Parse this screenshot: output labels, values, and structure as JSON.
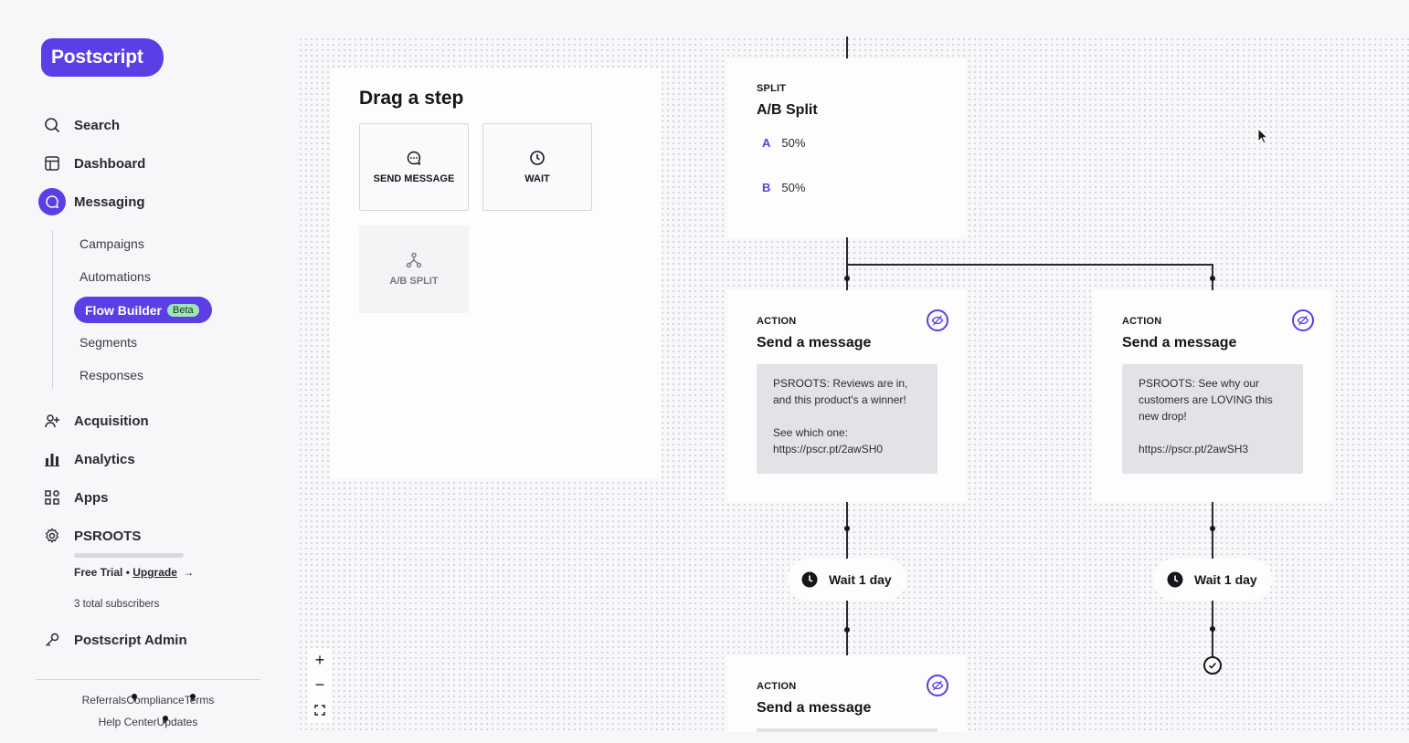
{
  "brand": {
    "logo": "Postscript",
    "accent": "#5b3ee6"
  },
  "nav": {
    "search": "Search",
    "dashboard": "Dashboard",
    "messaging": "Messaging",
    "sub": {
      "campaigns": "Campaigns",
      "automations": "Automations",
      "flow_builder": "Flow Builder",
      "beta": "Beta",
      "segments": "Segments",
      "responses": "Responses"
    },
    "acquisition": "Acquisition",
    "analytics": "Analytics",
    "apps": "Apps",
    "account": "PSROOTS",
    "trial_prefix": "Free Trial • ",
    "upgrade": "Upgrade",
    "subscribers": "3 total subscribers",
    "admin": "Postscript Admin"
  },
  "footer": {
    "referrals": "Referrals",
    "compliance": "Compliance",
    "terms": "Terms",
    "help": "Help Center",
    "updates": "Updates"
  },
  "panel": {
    "title": "Drag a step",
    "steps": {
      "send": "SEND MESSAGE",
      "wait": "WAIT",
      "split": "A/B SPLIT"
    }
  },
  "split_card": {
    "type": "SPLIT",
    "title": "A/B Split",
    "a_label": "A",
    "a_value": "50%",
    "b_label": "B",
    "b_value": "50%"
  },
  "action_left": {
    "type": "ACTION",
    "title": "Send a message",
    "body": "PSROOTS: Reviews are in, and this product's a winner!\n\nSee which one: https://pscr.pt/2awSH0"
  },
  "action_right": {
    "type": "ACTION",
    "title": "Send a message",
    "body": "PSROOTS: See why our customers are LOVING this new drop!\n\nhttps://pscr.pt/2awSH3"
  },
  "wait_left": "Wait 1 day",
  "wait_right": "Wait 1 day",
  "action_bottom": {
    "type": "ACTION",
    "title": "Send a message"
  },
  "zoom": {
    "in": "+",
    "out": "−"
  }
}
